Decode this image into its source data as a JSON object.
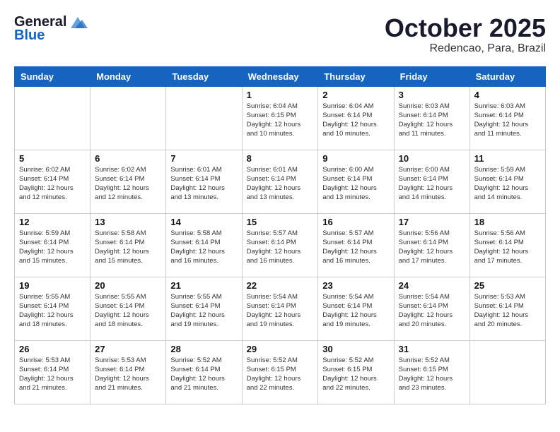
{
  "header": {
    "logo_general": "General",
    "logo_blue": "Blue",
    "month_title": "October 2025",
    "location": "Redencao, Para, Brazil"
  },
  "days_of_week": [
    "Sunday",
    "Monday",
    "Tuesday",
    "Wednesday",
    "Thursday",
    "Friday",
    "Saturday"
  ],
  "weeks": [
    [
      {
        "day": "",
        "info": ""
      },
      {
        "day": "",
        "info": ""
      },
      {
        "day": "",
        "info": ""
      },
      {
        "day": "1",
        "info": "Sunrise: 6:04 AM\nSunset: 6:15 PM\nDaylight: 12 hours\nand 10 minutes."
      },
      {
        "day": "2",
        "info": "Sunrise: 6:04 AM\nSunset: 6:14 PM\nDaylight: 12 hours\nand 10 minutes."
      },
      {
        "day": "3",
        "info": "Sunrise: 6:03 AM\nSunset: 6:14 PM\nDaylight: 12 hours\nand 11 minutes."
      },
      {
        "day": "4",
        "info": "Sunrise: 6:03 AM\nSunset: 6:14 PM\nDaylight: 12 hours\nand 11 minutes."
      }
    ],
    [
      {
        "day": "5",
        "info": "Sunrise: 6:02 AM\nSunset: 6:14 PM\nDaylight: 12 hours\nand 12 minutes."
      },
      {
        "day": "6",
        "info": "Sunrise: 6:02 AM\nSunset: 6:14 PM\nDaylight: 12 hours\nand 12 minutes."
      },
      {
        "day": "7",
        "info": "Sunrise: 6:01 AM\nSunset: 6:14 PM\nDaylight: 12 hours\nand 13 minutes."
      },
      {
        "day": "8",
        "info": "Sunrise: 6:01 AM\nSunset: 6:14 PM\nDaylight: 12 hours\nand 13 minutes."
      },
      {
        "day": "9",
        "info": "Sunrise: 6:00 AM\nSunset: 6:14 PM\nDaylight: 12 hours\nand 13 minutes."
      },
      {
        "day": "10",
        "info": "Sunrise: 6:00 AM\nSunset: 6:14 PM\nDaylight: 12 hours\nand 14 minutes."
      },
      {
        "day": "11",
        "info": "Sunrise: 5:59 AM\nSunset: 6:14 PM\nDaylight: 12 hours\nand 14 minutes."
      }
    ],
    [
      {
        "day": "12",
        "info": "Sunrise: 5:59 AM\nSunset: 6:14 PM\nDaylight: 12 hours\nand 15 minutes."
      },
      {
        "day": "13",
        "info": "Sunrise: 5:58 AM\nSunset: 6:14 PM\nDaylight: 12 hours\nand 15 minutes."
      },
      {
        "day": "14",
        "info": "Sunrise: 5:58 AM\nSunset: 6:14 PM\nDaylight: 12 hours\nand 16 minutes."
      },
      {
        "day": "15",
        "info": "Sunrise: 5:57 AM\nSunset: 6:14 PM\nDaylight: 12 hours\nand 16 minutes."
      },
      {
        "day": "16",
        "info": "Sunrise: 5:57 AM\nSunset: 6:14 PM\nDaylight: 12 hours\nand 16 minutes."
      },
      {
        "day": "17",
        "info": "Sunrise: 5:56 AM\nSunset: 6:14 PM\nDaylight: 12 hours\nand 17 minutes."
      },
      {
        "day": "18",
        "info": "Sunrise: 5:56 AM\nSunset: 6:14 PM\nDaylight: 12 hours\nand 17 minutes."
      }
    ],
    [
      {
        "day": "19",
        "info": "Sunrise: 5:55 AM\nSunset: 6:14 PM\nDaylight: 12 hours\nand 18 minutes."
      },
      {
        "day": "20",
        "info": "Sunrise: 5:55 AM\nSunset: 6:14 PM\nDaylight: 12 hours\nand 18 minutes."
      },
      {
        "day": "21",
        "info": "Sunrise: 5:55 AM\nSunset: 6:14 PM\nDaylight: 12 hours\nand 19 minutes."
      },
      {
        "day": "22",
        "info": "Sunrise: 5:54 AM\nSunset: 6:14 PM\nDaylight: 12 hours\nand 19 minutes."
      },
      {
        "day": "23",
        "info": "Sunrise: 5:54 AM\nSunset: 6:14 PM\nDaylight: 12 hours\nand 19 minutes."
      },
      {
        "day": "24",
        "info": "Sunrise: 5:54 AM\nSunset: 6:14 PM\nDaylight: 12 hours\nand 20 minutes."
      },
      {
        "day": "25",
        "info": "Sunrise: 5:53 AM\nSunset: 6:14 PM\nDaylight: 12 hours\nand 20 minutes."
      }
    ],
    [
      {
        "day": "26",
        "info": "Sunrise: 5:53 AM\nSunset: 6:14 PM\nDaylight: 12 hours\nand 21 minutes."
      },
      {
        "day": "27",
        "info": "Sunrise: 5:53 AM\nSunset: 6:14 PM\nDaylight: 12 hours\nand 21 minutes."
      },
      {
        "day": "28",
        "info": "Sunrise: 5:52 AM\nSunset: 6:14 PM\nDaylight: 12 hours\nand 21 minutes."
      },
      {
        "day": "29",
        "info": "Sunrise: 5:52 AM\nSunset: 6:15 PM\nDaylight: 12 hours\nand 22 minutes."
      },
      {
        "day": "30",
        "info": "Sunrise: 5:52 AM\nSunset: 6:15 PM\nDaylight: 12 hours\nand 22 minutes."
      },
      {
        "day": "31",
        "info": "Sunrise: 5:52 AM\nSunset: 6:15 PM\nDaylight: 12 hours\nand 23 minutes."
      },
      {
        "day": "",
        "info": ""
      }
    ]
  ]
}
